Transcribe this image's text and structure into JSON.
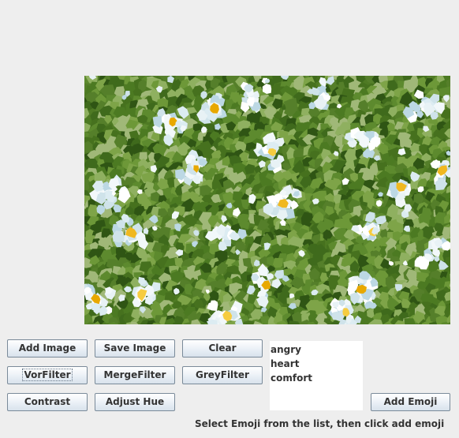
{
  "buttons": {
    "add_image": "Add Image",
    "save_image": "Save Image",
    "clear": "Clear",
    "vor_filter": "VorFilter",
    "merge_filter": "MergeFilter",
    "grey_filter": "GreyFilter",
    "contrast": "Contrast",
    "adjust_hue": "Adjust Hue",
    "add_emoji": "Add Emoji"
  },
  "emoji_list": {
    "items": [
      "angry",
      "heart",
      "comfort"
    ]
  },
  "status_text": "Select Emoji from the list, then click add emoji",
  "image": {
    "description_icon": "voronoi-filtered-flower-photo"
  },
  "colors": {
    "background": "#eeeeee",
    "foliage_dark": "#3f6a1c",
    "foliage_mid": "#5d8a2e",
    "foliage_light": "#8fb060",
    "petal_white": "#f2f8fa",
    "petal_blue": "#bcd8e4",
    "flower_center": "#f0b820"
  }
}
